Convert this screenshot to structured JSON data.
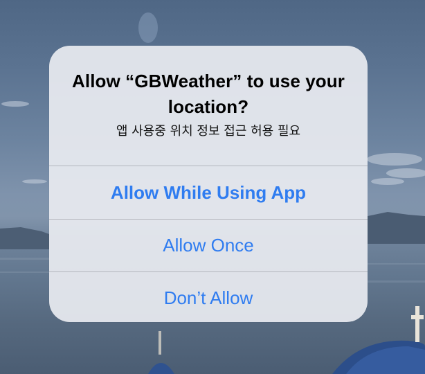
{
  "alert": {
    "title": "Allow “GBWeather” to use your location?",
    "message": "앱 사용중 위치 정보 접근 허용 필요",
    "buttons": {
      "allow_while_using": "Allow While Using App",
      "allow_once": "Allow Once",
      "dont_allow": "Don’t Allow"
    }
  },
  "colors": {
    "button_text": "#2f7cf0",
    "alert_background": "#e8ebf0"
  }
}
